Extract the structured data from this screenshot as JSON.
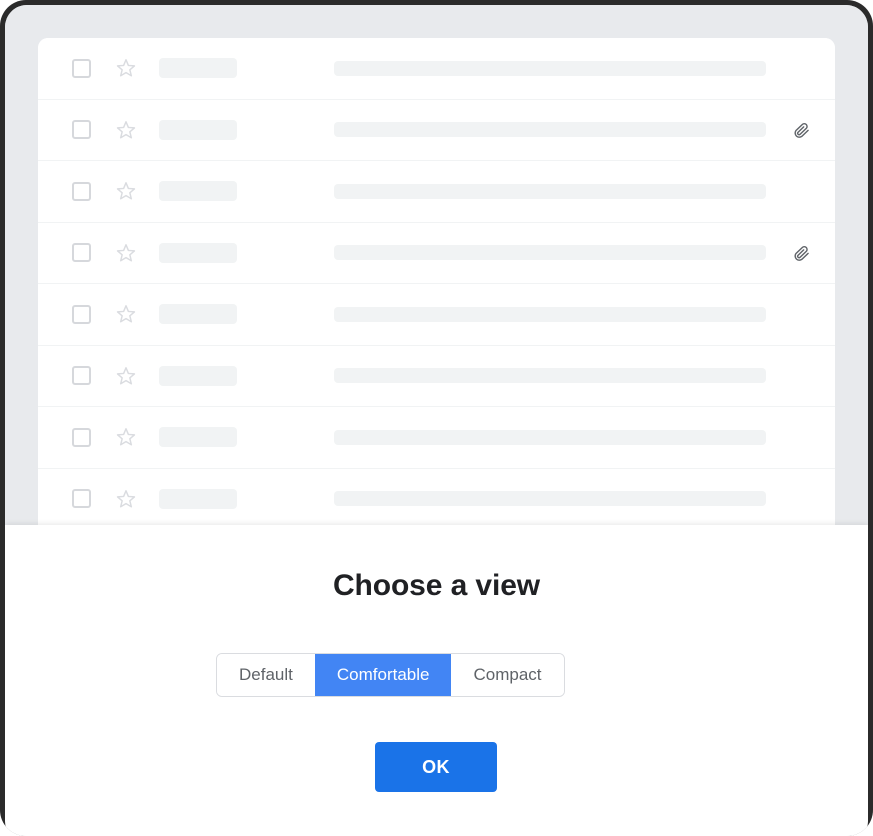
{
  "dialog": {
    "title": "Choose a view",
    "view_options": [
      {
        "label": "Default",
        "selected": false
      },
      {
        "label": "Comfortable",
        "selected": true
      },
      {
        "label": "Compact",
        "selected": false
      }
    ],
    "confirm_label": "OK"
  },
  "message_list": {
    "rows": [
      {
        "checkbox_icon": "checkbox-unchecked-icon",
        "star_icon": "star-outline-icon",
        "has_attachment": false
      },
      {
        "checkbox_icon": "checkbox-unchecked-icon",
        "star_icon": "star-outline-icon",
        "has_attachment": true
      },
      {
        "checkbox_icon": "checkbox-unchecked-icon",
        "star_icon": "star-outline-icon",
        "has_attachment": false
      },
      {
        "checkbox_icon": "checkbox-unchecked-icon",
        "star_icon": "star-outline-icon",
        "has_attachment": true
      },
      {
        "checkbox_icon": "checkbox-unchecked-icon",
        "star_icon": "star-outline-icon",
        "has_attachment": false
      },
      {
        "checkbox_icon": "checkbox-unchecked-icon",
        "star_icon": "star-outline-icon",
        "has_attachment": false
      },
      {
        "checkbox_icon": "checkbox-unchecked-icon",
        "star_icon": "star-outline-icon",
        "has_attachment": false
      },
      {
        "checkbox_icon": "checkbox-unchecked-icon",
        "star_icon": "star-outline-icon",
        "has_attachment": false
      }
    ]
  },
  "colors": {
    "accent_selected": "#4285f4",
    "accent_button": "#1a73e8",
    "backdrop": "#e8eaed",
    "panel": "#ffffff",
    "skeleton": "#f1f3f4",
    "divider": "#f1f3f4",
    "text_primary": "#202124",
    "text_secondary": "#5f6368",
    "frame": "#2b2b2b"
  }
}
